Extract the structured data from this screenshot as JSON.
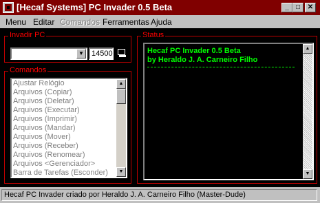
{
  "window": {
    "title": "[Hecaf Systems] PC Invader 0.5 Beta",
    "controls": {
      "minimize_icon": "_",
      "maximize_icon": "□",
      "close_icon": "✕"
    }
  },
  "menu": [
    {
      "label": "Menu",
      "enabled": true
    },
    {
      "label": "Editar",
      "enabled": true
    },
    {
      "label": "Comandos",
      "enabled": false
    },
    {
      "label": "Ferramentas",
      "enabled": true
    },
    {
      "label": "Ajuda",
      "enabled": true
    }
  ],
  "invadir": {
    "title": "Invadir PC",
    "host_value": "",
    "port_value": "14500",
    "connect_icon": "computer-connect-icon"
  },
  "comandos": {
    "title": "Comandos",
    "items": [
      "Ajustar Relógio",
      "Arquivos (Copiar)",
      "Arquivos (Deletar)",
      "Arquivos (Executar)",
      "Arquivos (Imprimir)",
      "Arquivos (Mandar)",
      "Arquivos (Mover)",
      "Arquivos (Receber)",
      "Arquivos (Renomear)",
      "Arquivos <Gerenciador>",
      "Barra de Tarefas (Esconder)"
    ]
  },
  "status": {
    "title": "Status",
    "lines": [
      "Hecaf PC Invader 0.5 Beta",
      "by Heraldo J. A. Carneiro Filho"
    ]
  },
  "statusbar": {
    "text": "Hecaf PC Invader criado por Heraldo J. A. Carneiro Filho (Master-Dude)"
  },
  "colors": {
    "title_bar": "#800000",
    "group_border": "#c00000",
    "group_title": "#ff0000",
    "status_text": "#00ff00",
    "background": "#000000"
  }
}
